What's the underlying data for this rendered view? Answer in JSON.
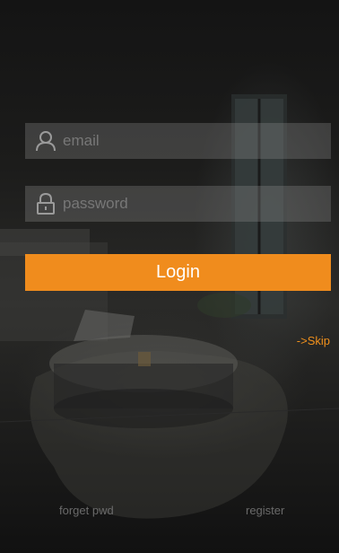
{
  "login_form": {
    "email_placeholder": "email",
    "password_placeholder": "password",
    "login_label": "Login"
  },
  "links": {
    "skip_label": "->Skip",
    "forget_label": "forget pwd",
    "register_label": "register"
  },
  "icons": {
    "email": "user-icon",
    "password": "lock-icon"
  },
  "colors": {
    "accent": "#f08c1d",
    "field_bg": "#5a5a5a"
  }
}
